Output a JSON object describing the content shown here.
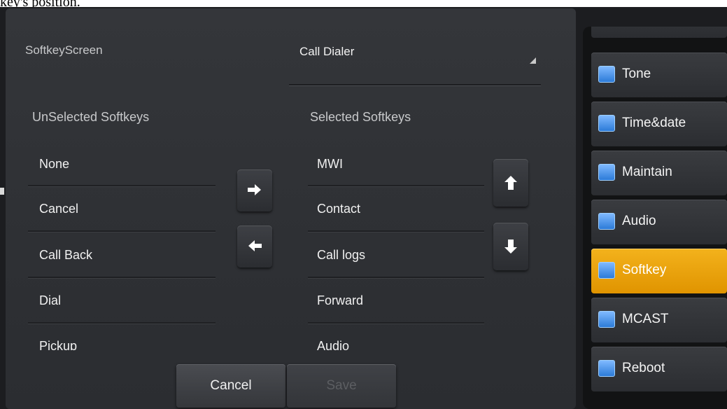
{
  "top_text": "key's position.",
  "form": {
    "screen_label": "SoftkeyScreen",
    "screen_value": "Call Dialer",
    "unselected_header": "UnSelected Softkeys",
    "selected_header": "Selected Softkeys"
  },
  "unselected": [
    "None",
    "Cancel",
    "Call Back",
    "Dial",
    "Pickup"
  ],
  "selected": [
    "MWI",
    "Contact",
    "Call logs",
    "Forward",
    "Audio"
  ],
  "buttons": {
    "cancel": "Cancel",
    "save": "Save"
  },
  "icons": {
    "move_right": "arrow-right-icon",
    "move_left": "arrow-left-icon",
    "move_up": "arrow-up-icon",
    "move_down": "arrow-down-icon"
  },
  "sidebar": {
    "items": [
      {
        "label": "Tone",
        "icon": "speaker-icon"
      },
      {
        "label": "Time&date",
        "icon": "clock-icon"
      },
      {
        "label": "Maintain",
        "icon": "tools-icon"
      },
      {
        "label": "Audio",
        "icon": "microphone-icon"
      },
      {
        "label": "Softkey",
        "icon": "keyboard-icon",
        "active": true
      },
      {
        "label": "MCAST",
        "icon": "multicast-icon"
      },
      {
        "label": "Reboot",
        "icon": "reboot-icon"
      }
    ]
  },
  "colors": {
    "accent": "#f0a80f",
    "panel": "#313337",
    "text": "#f1f1f1"
  }
}
